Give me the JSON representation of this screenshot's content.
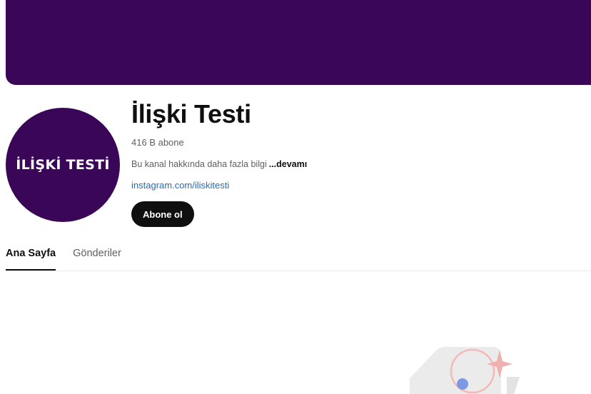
{
  "channel": {
    "avatar_text": "İLİŞKİ TESTİ",
    "name": "İlişki Testi",
    "subscribers": "416 B abone",
    "description": "Bu kanal hakkında daha fazla bilgi",
    "more_label": "...devamı",
    "link": "instagram.com/iliskitesti",
    "subscribe_label": "Abone ol"
  },
  "tabs": [
    {
      "label": "Ana Sayfa",
      "active": true
    },
    {
      "label": "Gönderiler",
      "active": false
    }
  ],
  "colors": {
    "banner": "#3a0758",
    "avatar_bg": "#3a0758",
    "button_bg": "#0f0f0f",
    "link": "#2a6bb0"
  }
}
